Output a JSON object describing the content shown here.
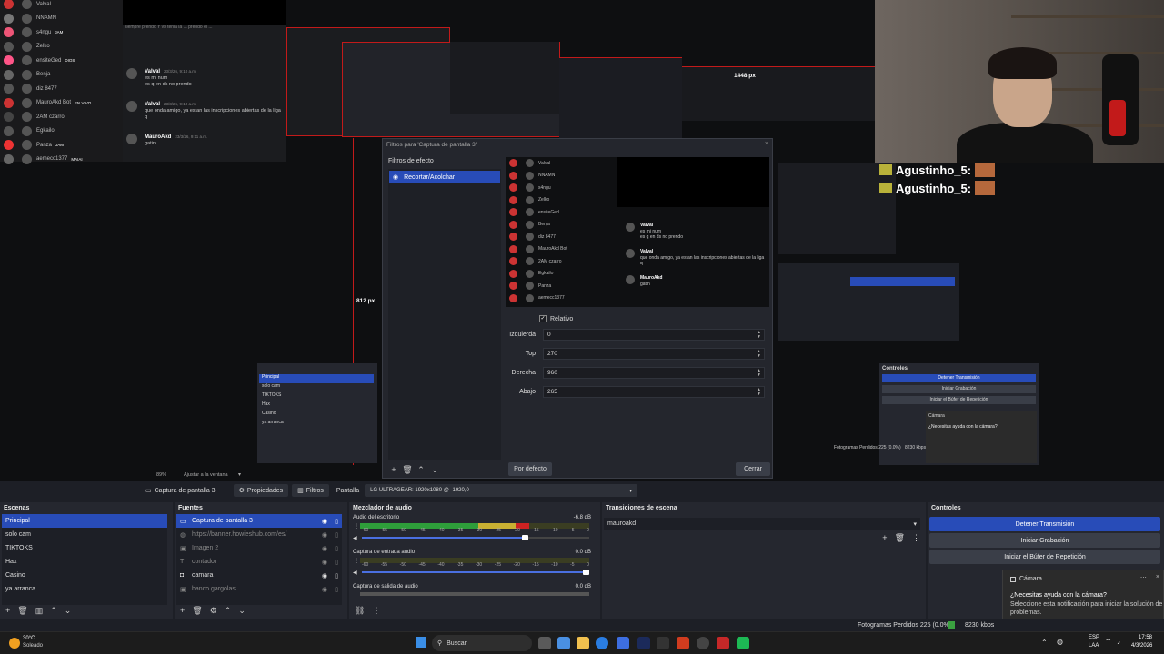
{
  "preview": {
    "chat_users": [
      "Valval",
      "NNAMN",
      "s4ngu",
      "Zelko",
      "ensiteGed",
      "Benja",
      "diz 8477",
      "MauroAkd Bot",
      "2AM czarro",
      "Egkailo",
      "Panza",
      "aemecc1377"
    ],
    "chat_badges": [
      "",
      "",
      "JAM",
      "",
      "DIOS",
      "",
      "",
      "EN VIVO",
      "",
      "",
      "JAM",
      "MAIAI"
    ],
    "messages": [
      {
        "user": "Valval",
        "time": "23/3/26, 9:10 a.m.",
        "lines": [
          "es mi num",
          "es q en ds no prendo"
        ]
      },
      {
        "user": "Valval",
        "time": "23/3/26, 9:10 a.m.",
        "lines": [
          "que onda amigo, ya estan las inscripciones abiertas de la liga q"
        ]
      },
      {
        "user": "MauroAkd",
        "time": "23/3/26, 9:11 a.m.",
        "lines": [
          "gatin"
        ]
      }
    ],
    "top_text": "siempre prendo Y vs tenia la ... prendo el ...",
    "px_width": "1448 px",
    "px_height": "812 px",
    "chat_overlay": [
      "Agustinho_5:",
      "Agustinho_5:"
    ],
    "overlay_scenes": [
      "Principal",
      "solo cam",
      "TIKTOKS",
      "Hax",
      "Casino",
      "ya arranca"
    ],
    "overlay_controls": "Controles",
    "overlay_controls_btns": [
      "Detener Transmisión",
      "Iniciar Grabación",
      "Iniciar el Búfer de Repetición"
    ],
    "overlay_camera_title": "Cámara",
    "overlay_camera_msg": "¿Necesitas ayuda con la cámara?",
    "overlay_status": "Fotogramas Perdidos 225 (0.0%)",
    "overlay_kbps": "8230 kbps",
    "zoom": "89%",
    "zoom_fit": "Ajustar a la ventana"
  },
  "dialog": {
    "title": "Filtros para 'Captura de pantalla 3'",
    "section_label": "Filtros de efecto",
    "filter_item": "Recortar/Acolchar",
    "relative_label": "Relativo",
    "fields": [
      {
        "label": "Izquierda",
        "value": "0"
      },
      {
        "label": "Top",
        "value": "270"
      },
      {
        "label": "Derecha",
        "value": "960"
      },
      {
        "label": "Abajo",
        "value": "265"
      }
    ],
    "default_btn": "Por defecto",
    "close_btn": "Cerrar"
  },
  "toolbar": {
    "source_name": "Captura de pantalla 3",
    "properties": "Propiedades",
    "filters": "Filtros",
    "screen_label": "Pantalla",
    "screen_value": "LG ULTRAGEAR: 1920x1080 @ -1920,0"
  },
  "scenes": {
    "title": "Escenas",
    "items": [
      "Principal",
      "solo cam",
      "TIKTOKS",
      "Hax",
      "Casino",
      "ya arranca"
    ]
  },
  "sources": {
    "title": "Fuentes",
    "items": [
      {
        "name": "Captura de pantalla 3",
        "icon": "monitor-icon"
      },
      {
        "name": "https://banner.howieshub.com/es/",
        "icon": "globe-icon"
      },
      {
        "name": "Imagen 2",
        "icon": "image-icon"
      },
      {
        "name": "contador",
        "icon": "text-icon"
      },
      {
        "name": "camara",
        "icon": "camera-icon"
      },
      {
        "name": "banco gargolas",
        "icon": "image-icon"
      }
    ]
  },
  "mixer": {
    "title": "Mezclador de audio",
    "channels": [
      {
        "name": "Audio del escritorio",
        "db": "-6.8 dB"
      },
      {
        "name": "Captura de entrada audio",
        "db": "0.0 dB"
      },
      {
        "name": "Captura de salida de audio",
        "db": "0.0 dB"
      }
    ],
    "scale": [
      "-60",
      "-55",
      "-50",
      "-45",
      "-40",
      "-35",
      "-30",
      "-25",
      "-20",
      "-15",
      "-10",
      "-5",
      "0"
    ],
    "desktop_level": 0.74,
    "desktop_volume": 0.73,
    "input_volume": 1.0
  },
  "transitions": {
    "title": "Transiciones de escena",
    "selected": "mauroakd"
  },
  "controls": {
    "title": "Controles",
    "stop_stream": "Detener Transmisión",
    "start_rec": "Iniciar Grabación",
    "replay": "Iniciar el Búfer de Repetición"
  },
  "notification": {
    "title": "Cámara",
    "heading": "¿Necesitas ayuda con la cámara?",
    "body": "Seleccione esta notificación para iniciar la solución de problemas."
  },
  "status": {
    "frames": "Fotogramas Perdidos 225 (0.0%)",
    "kbps": "8230 kbps"
  },
  "taskbar": {
    "weather_temp": "30°C",
    "weather_desc": "Soleado",
    "search": "Buscar",
    "lang1": "ESP",
    "lang2": "LAA",
    "time": "17:58",
    "date": "4/3/2026"
  },
  "colors": {
    "accent": "#284cb8",
    "panel": "#25272f",
    "background": "#1d1f26"
  }
}
